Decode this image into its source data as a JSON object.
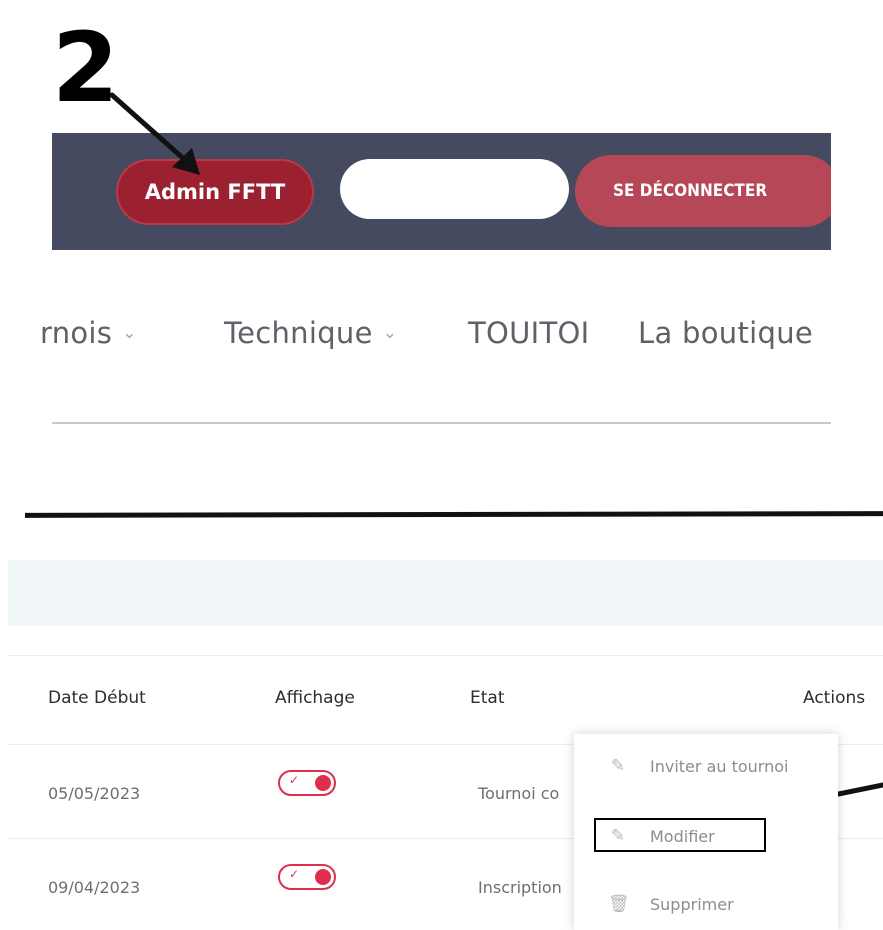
{
  "step_number": "2",
  "topbar": {
    "admin_label": "Admin FFTT",
    "logout_label": "SE DÉCONNECTER"
  },
  "nav": {
    "items": [
      {
        "label": "rnois",
        "has_dropdown": true
      },
      {
        "label": "Technique",
        "has_dropdown": true
      },
      {
        "label": "TOUITOI",
        "has_dropdown": false
      },
      {
        "label": "La boutique",
        "has_dropdown": false
      }
    ]
  },
  "table": {
    "headers": {
      "date": "Date Début",
      "display": "Affichage",
      "state": "Etat",
      "actions": "Actions"
    },
    "rows": [
      {
        "date": "05/05/2023",
        "display_on": true,
        "state": "Tournoi co"
      },
      {
        "date": "09/04/2023",
        "display_on": true,
        "state": "Inscription"
      }
    ]
  },
  "actions_menu": {
    "items": [
      {
        "label": "Inviter au tournoi",
        "icon": "pencil-icon"
      },
      {
        "label": "Modifier",
        "icon": "pencil-icon"
      },
      {
        "label": "Supprimer",
        "icon": "trash-icon"
      }
    ]
  },
  "colors": {
    "topbar_bg": "#464a61",
    "admin_button": "#9b2030",
    "logout_button": "#b64756",
    "toggle_accent": "#dd2f4d",
    "header_band": "#f1f6f9"
  }
}
